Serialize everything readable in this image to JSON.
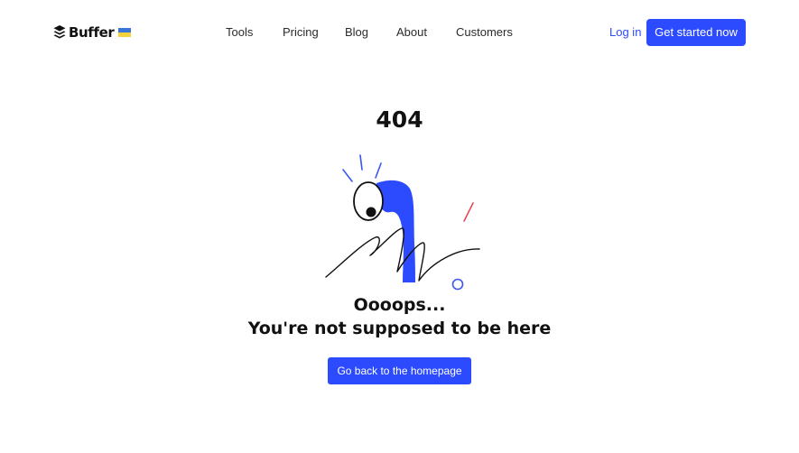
{
  "header": {
    "logo_text": "Buffer",
    "flag_colors": {
      "top": "#3a76d8",
      "bottom": "#f4d23b"
    },
    "nav": [
      {
        "label": "Tools"
      },
      {
        "label": "Pricing"
      },
      {
        "label": "Blog"
      },
      {
        "label": "About"
      },
      {
        "label": "Customers"
      }
    ],
    "login_label": "Log in",
    "cta_label": "Get started now"
  },
  "main": {
    "error_code": "404",
    "headline": "Oooops...",
    "subheadline": "You're not supposed to be here",
    "home_button_label": "Go back to the homepage"
  },
  "colors": {
    "accent": "#2c4bff",
    "text": "#111111",
    "decor_red": "#e8495a"
  }
}
